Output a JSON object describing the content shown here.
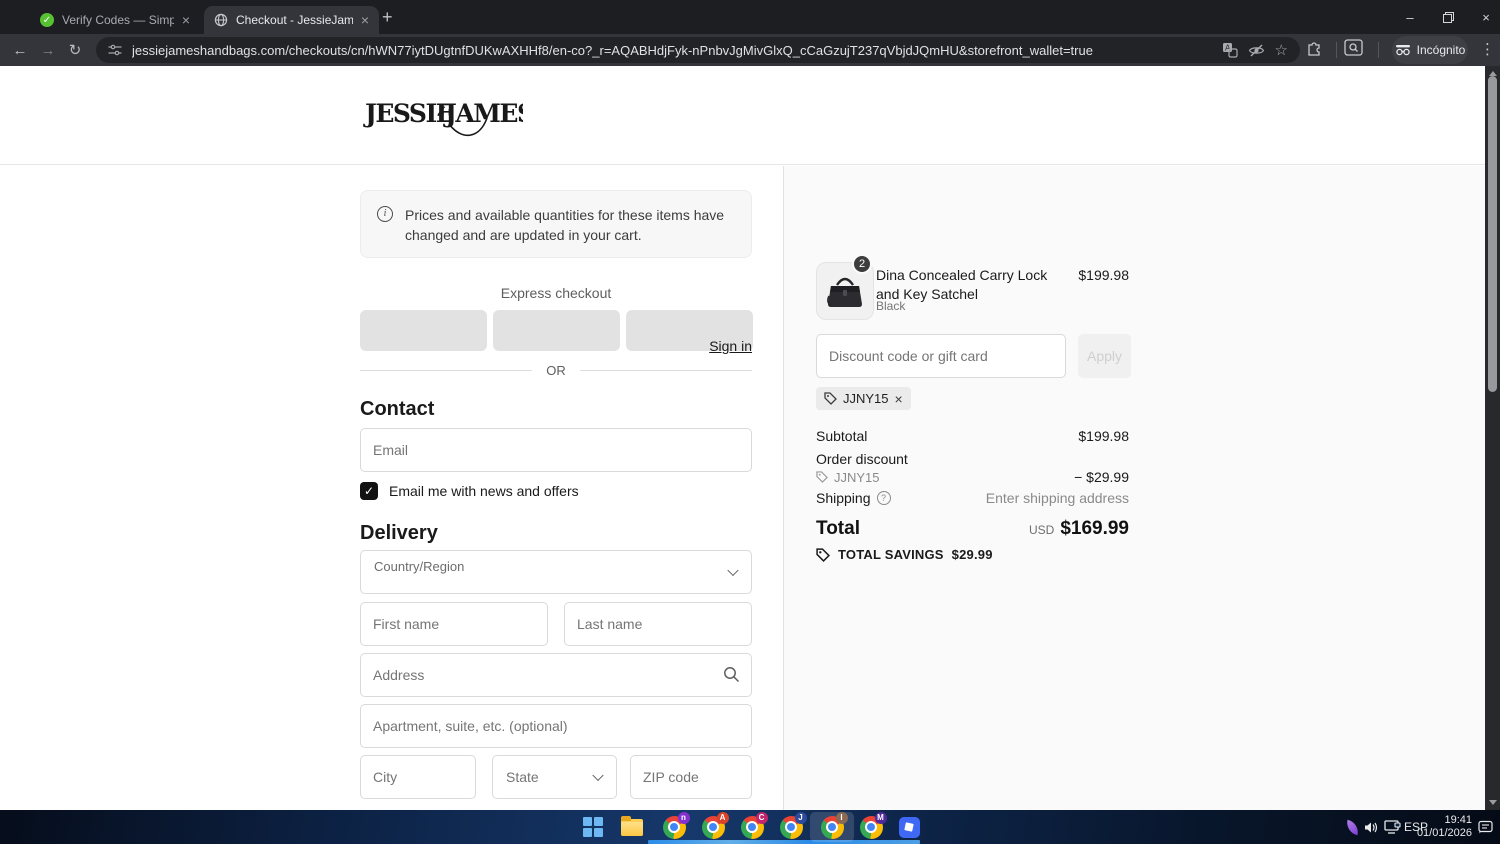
{
  "colors": {
    "brand_text": "#1a1a1a",
    "sidebar_bg": "#fafafa",
    "chrome_dark": "#1d1e21",
    "toolbar": "#34353a",
    "taskbar_blue": "#16386b"
  },
  "browser": {
    "tabs": [
      {
        "title": "Verify Codes — SimplyCodes"
      },
      {
        "title": "Checkout - JessieJames Handba"
      }
    ],
    "close_glyph": "×",
    "newtab_glyph": "+",
    "back_glyph": "←",
    "forward_glyph": "→",
    "reload_glyph": "↻",
    "url": "jessiejameshandbags.com/checkouts/cn/hWN77iytDUgtnfDUKwAXHHf8/en-co?_r=AQABHdjFyk-nPnbvJgMivGlxQ_cCaGzujT237qVbjdJQmHU&storefront_wallet=true",
    "incognito_label": "Incógnito",
    "menu_glyph": "⋮",
    "star_glyph": "☆",
    "minimize_glyph": "–",
    "close_window_glyph": "×"
  },
  "header": {
    "brand_left": "JESSIE",
    "brand_mark": "✗",
    "brand_right": "JAMES"
  },
  "checkout": {
    "banner_text": "Prices and available quantities for these items have changed and are updated in your cart.",
    "banner_icon_glyph": "i",
    "express_label": "Express checkout",
    "or_label": "OR",
    "contact_heading": "Contact",
    "signin_label": "Sign in",
    "email_placeholder": "Email",
    "newsletter_label": "Email me with news and offers",
    "newsletter_check_glyph": "✓",
    "delivery_heading": "Delivery",
    "country_label": "Country/Region",
    "first_name_placeholder": "First name",
    "last_name_placeholder": "Last name",
    "address_placeholder": "Address",
    "apartment_placeholder": "Apartment, suite, etc. (optional)",
    "city_placeholder": "City",
    "state_label": "State",
    "zip_placeholder": "ZIP code"
  },
  "summary": {
    "item": {
      "qty": "2",
      "title": "Dina Concealed Carry Lock and Key Satchel",
      "variant": "Black",
      "price": "$199.98"
    },
    "discount_placeholder": "Discount code or gift card",
    "apply_label": "Apply",
    "chip_code": "JJNY15",
    "chip_close_glyph": "×",
    "subtotal_label": "Subtotal",
    "subtotal_value": "$199.98",
    "order_discount_label": "Order discount",
    "discount_code": "JJNY15",
    "discount_amount": "− $29.99",
    "shipping_label": "Shipping",
    "shipping_help_glyph": "?",
    "shipping_value": "Enter shipping address",
    "total_label": "Total",
    "currency": "USD",
    "total_value": "$169.99",
    "savings_label": "TOTAL SAVINGS",
    "savings_value": "$29.99"
  },
  "taskbar": {
    "language": "ESP",
    "time": "19:41",
    "date": "01/01/2026"
  }
}
